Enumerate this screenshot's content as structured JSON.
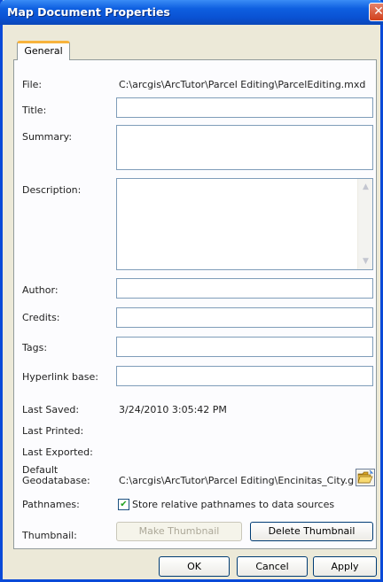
{
  "window": {
    "title": "Map Document Properties",
    "close_glyph": "✕"
  },
  "tabs": [
    {
      "label": "General"
    }
  ],
  "labels": {
    "file": "File:",
    "title": "Title:",
    "summary": "Summary:",
    "description": "Description:",
    "author": "Author:",
    "credits": "Credits:",
    "tags": "Tags:",
    "hyperlink": "Hyperlink base:",
    "last_saved": "Last Saved:",
    "last_printed": "Last Printed:",
    "last_exported": "Last Exported:",
    "default_gdb_1": "Default",
    "default_gdb_2": "Geodatabase:",
    "pathnames": "Pathnames:",
    "thumbnail": "Thumbnail:"
  },
  "values": {
    "file": "C:\\arcgis\\ArcTutor\\Parcel Editing\\ParcelEditing.mxd",
    "title": "",
    "summary": "",
    "description": "",
    "author": "",
    "credits": "",
    "tags": "",
    "hyperlink": "",
    "last_saved": "3/24/2010 3:05:42 PM",
    "last_printed": "",
    "last_exported": "",
    "default_gdb": "C:\\arcgis\\ArcTutor\\Parcel Editing\\Encinitas_City.g"
  },
  "pathnames_checkbox": {
    "label": "Store relative pathnames to data sources",
    "checked": true,
    "glyph": "✔"
  },
  "buttons": {
    "make_thumbnail": "Make Thumbnail",
    "delete_thumbnail": "Delete Thumbnail",
    "ok": "OK",
    "cancel": "Cancel",
    "apply": "Apply"
  },
  "icons": {
    "browse_gdb": "folder-open-icon",
    "scroll_up": "▲",
    "scroll_down": "▼"
  }
}
